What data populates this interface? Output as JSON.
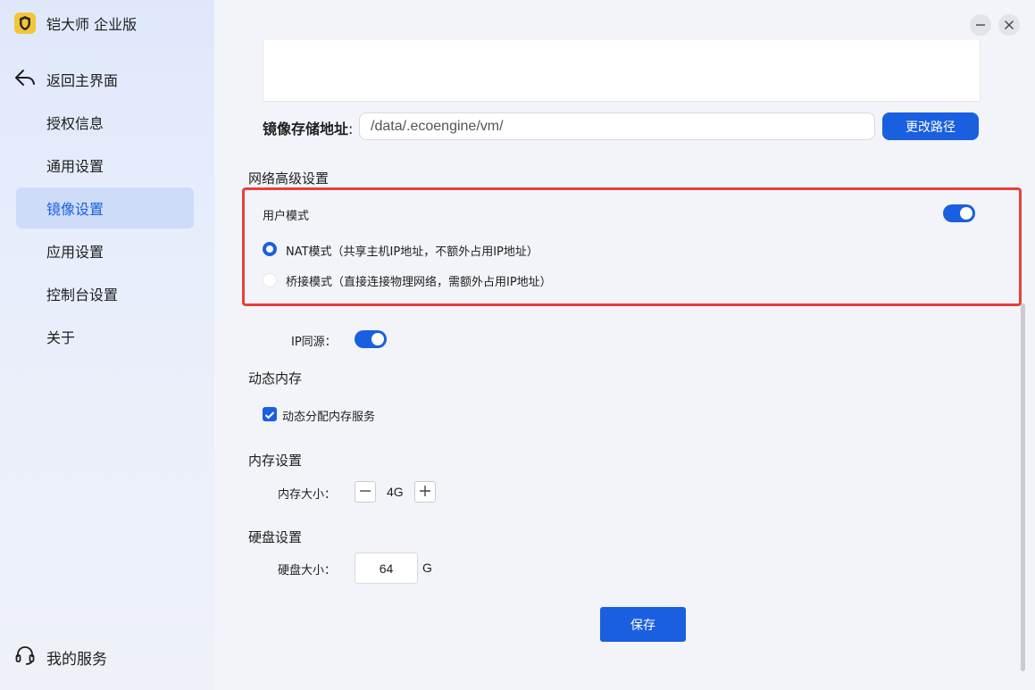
{
  "app": {
    "title": "铠大师 企业版",
    "logo_icon": "shield-logo-icon"
  },
  "sidebar": {
    "back_label": "返回主界面",
    "items": [
      {
        "label": "授权信息",
        "active": false
      },
      {
        "label": "通用设置",
        "active": false
      },
      {
        "label": "镜像设置",
        "active": true
      },
      {
        "label": "应用设置",
        "active": false
      },
      {
        "label": "控制台设置",
        "active": false
      },
      {
        "label": "关于",
        "active": false
      }
    ],
    "service_label": "我的服务"
  },
  "storage": {
    "label": "镜像存储地址",
    "colon": ":",
    "path_value": "/data/.ecoengine/vm/",
    "change_button": "更改路径"
  },
  "network": {
    "section_title": "网络高级设置",
    "user_mode_label": "用户模式",
    "user_mode_enabled": true,
    "options": [
      {
        "label": "NAT模式（共享主机IP地址，不额外占用IP地址）",
        "selected": true
      },
      {
        "label": "桥接模式（直接连接物理网络，需额外占用IP地址）",
        "selected": false
      }
    ],
    "ip_same_source_label": "IP同源：",
    "ip_same_source_enabled": true
  },
  "dynamic_memory": {
    "section_title": "动态内存",
    "checkbox_label": "动态分配内存服务",
    "checked": true
  },
  "memory": {
    "section_title": "内存设置",
    "size_label": "内存大小：",
    "value": "4G"
  },
  "disk": {
    "section_title": "硬盘设置",
    "size_label": "硬盘大小：",
    "value": "64",
    "unit": "G"
  },
  "save_button": "保存",
  "colors": {
    "accent": "#1a5fe0",
    "highlight_border": "#e5413b",
    "active_nav_bg": "#cfdcf8"
  }
}
